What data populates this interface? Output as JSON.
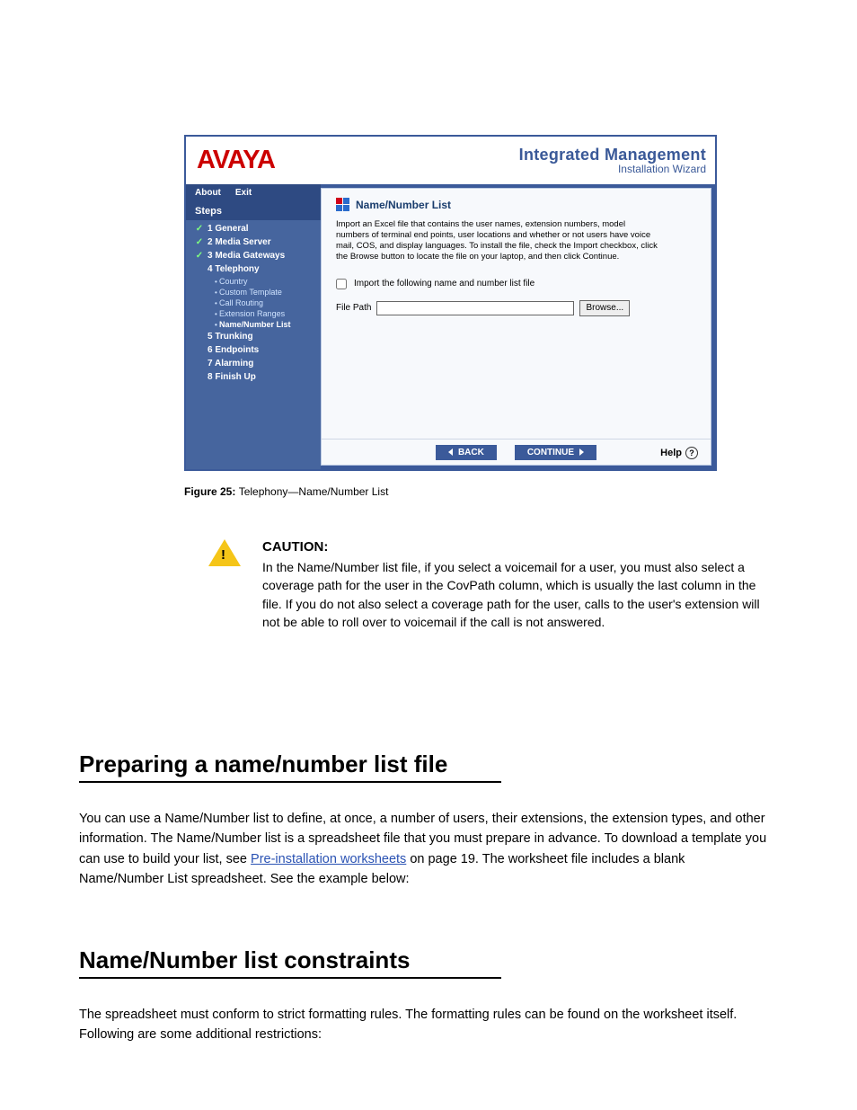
{
  "screenshot": {
    "logo_text": "AVAYA",
    "brand_title": "Integrated Management",
    "brand_sub": "Installation Wizard",
    "menu": {
      "about": "About",
      "exit": "Exit"
    },
    "steps_title": "Steps",
    "steps": [
      {
        "label": "1 General",
        "done": true
      },
      {
        "label": "2 Media Server",
        "done": true
      },
      {
        "label": "3 Media Gateways",
        "done": true
      },
      {
        "label": "4 Telephony",
        "done": false,
        "subs": [
          {
            "label": "Country",
            "active": false
          },
          {
            "label": "Custom Template",
            "active": false
          },
          {
            "label": "Call Routing",
            "active": false
          },
          {
            "label": "Extension Ranges",
            "active": false
          },
          {
            "label": "Name/Number List",
            "active": true
          }
        ]
      },
      {
        "label": "5 Trunking",
        "done": false
      },
      {
        "label": "6 Endpoints",
        "done": false
      },
      {
        "label": "7 Alarming",
        "done": false
      },
      {
        "label": "8 Finish Up",
        "done": false
      }
    ],
    "page_title": "Name/Number List",
    "instructions_html": "Import an Excel file that contains the user names, extension numbers, model numbers of terminal end points, user locations and whether or not users have voice mail, COS, and display languages. To install the file, check the Import checkbox, click the Browse button to locate the file on your laptop, and then click Continue.",
    "checkbox_label": "Import the following name and number list file",
    "filepath_label": "File Path",
    "browse_label": "Browse...",
    "back_label": "BACK",
    "continue_label": "CONTINUE",
    "help_label": "Help"
  },
  "caption": {
    "prefix": "Figure 25: ",
    "text": "Telephony—Name/Number List"
  },
  "caution": {
    "title": "CAUTION:",
    "body": "In the Name/Number list file, if you select a voicemail for a user, you must also select a coverage path for the user in the CovPath column, which is usually the last column in the file. If you do not also select a coverage path for the user, calls to the user's extension will not be able to roll over to voicemail if the call is not answered."
  },
  "sections": {
    "s1": {
      "heading": "Preparing a name/number list file",
      "body_pre": "You can use a Name/Number list to define, at once, a number of users, their extensions, the extension types, and other information. The Name/Number list is a spreadsheet file that you must prepare in advance. To download a template you can use to build your list, see ",
      "body_link": "Pre-installation worksheets",
      "body_post": " on page 19. The worksheet file includes a blank Name/Number List spreadsheet. See the example below:"
    },
    "s2": {
      "heading": "Name/Number list constraints",
      "body": "The spreadsheet must conform to strict formatting rules. The formatting rules can be found on the worksheet itself. Following are some additional restrictions:"
    }
  }
}
